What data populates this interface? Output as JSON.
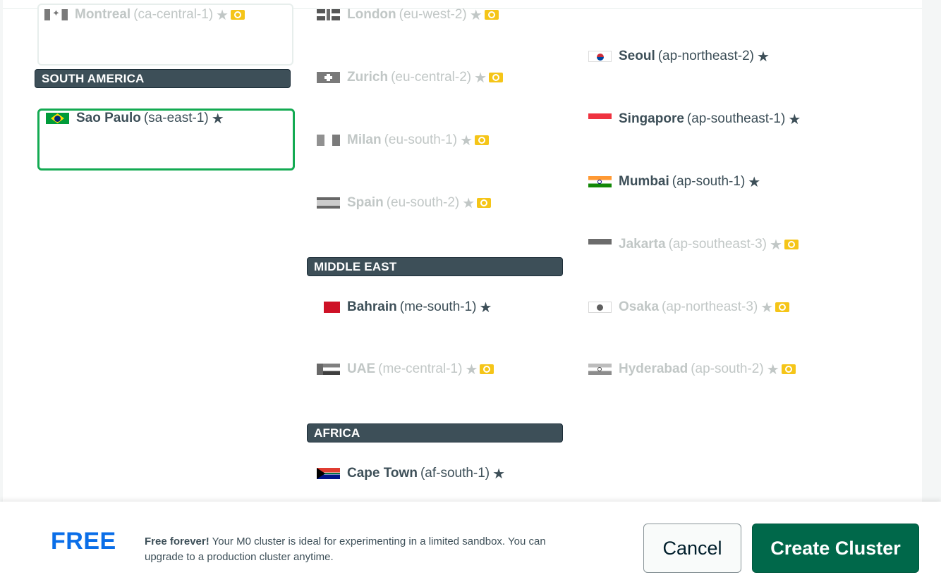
{
  "regions": {
    "montreal": {
      "name": "Montreal",
      "code": "(ca-central-1)"
    },
    "london": {
      "name": "London",
      "code": "(eu-west-2)"
    },
    "zurich": {
      "name": "Zurich",
      "code": "(eu-central-2)"
    },
    "milan": {
      "name": "Milan",
      "code": "(eu-south-1)"
    },
    "spain": {
      "name": "Spain",
      "code": "(eu-south-2)"
    },
    "sao_paulo": {
      "name": "Sao Paulo",
      "code": "(sa-east-1)"
    },
    "bahrain": {
      "name": "Bahrain",
      "code": "(me-south-1)"
    },
    "uae": {
      "name": "UAE",
      "code": "(me-central-1)"
    },
    "cape_town": {
      "name": "Cape Town",
      "code": "(af-south-1)"
    },
    "seoul": {
      "name": "Seoul",
      "code": "(ap-northeast-2)"
    },
    "singapore": {
      "name": "Singapore",
      "code": "(ap-southeast-1)"
    },
    "mumbai": {
      "name": "Mumbai",
      "code": "(ap-south-1)"
    },
    "jakarta": {
      "name": "Jakarta",
      "code": "(ap-southeast-3)"
    },
    "osaka": {
      "name": "Osaka",
      "code": "(ap-northeast-3)"
    },
    "hyderabad": {
      "name": "Hyderabad",
      "code": "(ap-south-2)"
    }
  },
  "headers": {
    "south_america": "SOUTH AMERICA",
    "middle_east": "MIDDLE EAST",
    "africa": "AFRICA"
  },
  "footer": {
    "tier": "FREE",
    "description_bold": "Free forever!",
    "description": " Your M0 cluster is ideal for experimenting in a limited sandbox. You can upgrade to a production cluster anytime.",
    "cancel_label": "Cancel",
    "create_label": "Create Cluster"
  },
  "colors": {
    "header_bg": "#3d4f58",
    "selected_border": "#13aa52",
    "free_label": "#0a6ee8",
    "create_button": "#00684a",
    "coin": "#f5c518"
  },
  "icons": {
    "star": "star-icon",
    "coin": "dollar-bill-icon"
  }
}
